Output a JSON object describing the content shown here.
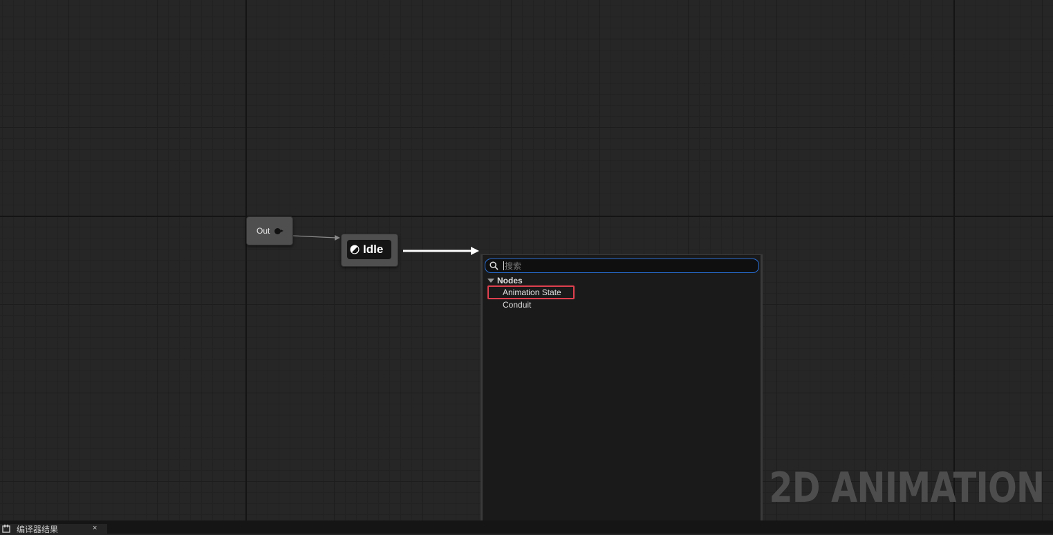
{
  "graph": {
    "out_node": {
      "label": "Out"
    },
    "idle_node": {
      "label": "Idle"
    }
  },
  "context_menu": {
    "search": {
      "placeholder": "搜索",
      "value": ""
    },
    "category": {
      "label": "Nodes",
      "expanded": true
    },
    "items": [
      {
        "label": "Animation State",
        "highlighted": true
      },
      {
        "label": "Conduit",
        "highlighted": false
      }
    ]
  },
  "watermark": {
    "text": "2D ANIMATION"
  },
  "bottom_panel": {
    "tab_label": "编译器结果",
    "close_glyph": "×"
  },
  "colors": {
    "graph_bg": "#262626",
    "node_bg": "#4f4f4f",
    "search_border": "#2a6fd6",
    "highlight_border": "#e0404f"
  }
}
